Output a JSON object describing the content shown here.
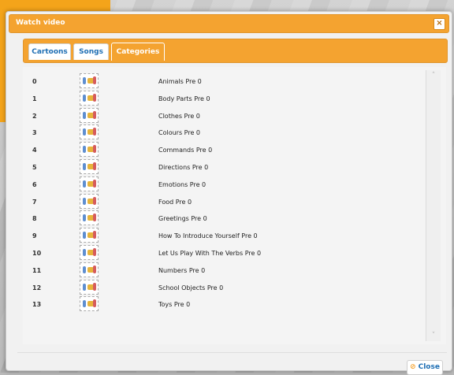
{
  "window": {
    "title": "Watch video",
    "close_symbol": "×"
  },
  "tabs": [
    {
      "label": "Cartoons"
    },
    {
      "label": "Songs"
    },
    {
      "label": "Categories",
      "active": true
    }
  ],
  "rows": [
    {
      "num": "0",
      "label": "Animals Pre 0"
    },
    {
      "num": "1",
      "label": "Body Parts Pre 0"
    },
    {
      "num": "2",
      "label": "Clothes Pre 0"
    },
    {
      "num": "3",
      "label": "Colours Pre 0"
    },
    {
      "num": "4",
      "label": "Commands Pre 0"
    },
    {
      "num": "5",
      "label": "Directions Pre 0"
    },
    {
      "num": "6",
      "label": "Emotions Pre 0"
    },
    {
      "num": "7",
      "label": "Food Pre 0"
    },
    {
      "num": "8",
      "label": "Greetings Pre 0"
    },
    {
      "num": "9",
      "label": "How To Introduce Yourself Pre 0"
    },
    {
      "num": "10",
      "label": "Let Us Play With The Verbs Pre 0"
    },
    {
      "num": "11",
      "label": "Numbers Pre 0"
    },
    {
      "num": "12",
      "label": "School Objects Pre 0"
    },
    {
      "num": "13",
      "label": "Toys Pre 0"
    }
  ],
  "footer": {
    "close_label": "Close"
  },
  "colors": {
    "accent": "#f4a330",
    "tab_text": "#1f6fb4"
  },
  "icons": {
    "window_close": "close-icon",
    "footer_close": "close-circle-icon",
    "scroll_up": "chevron-up-icon",
    "scroll_down": "chevron-down-icon"
  }
}
